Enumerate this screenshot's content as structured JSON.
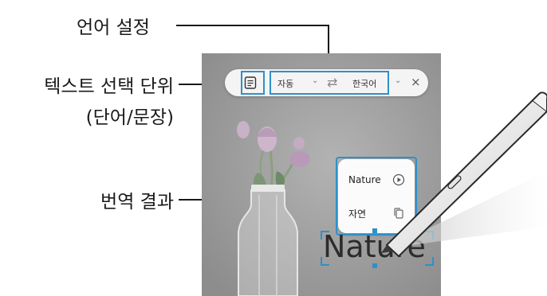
{
  "callouts": {
    "language_setting": "언어 설정",
    "text_select_unit_line1": "텍스트 선택 단위",
    "text_select_unit_line2": "(단어/문장)",
    "translation_result": "번역 결과"
  },
  "toolbar": {
    "source_language": "자동",
    "target_language": "한국어",
    "swap_symbol": "⇄",
    "close_symbol": "×"
  },
  "translation_popup": {
    "source_word": "Nature",
    "translated_word": "자연"
  },
  "selected_text": "Nature",
  "colors": {
    "highlight": "#2e90c9",
    "photo_background": "#9a9a9a"
  }
}
